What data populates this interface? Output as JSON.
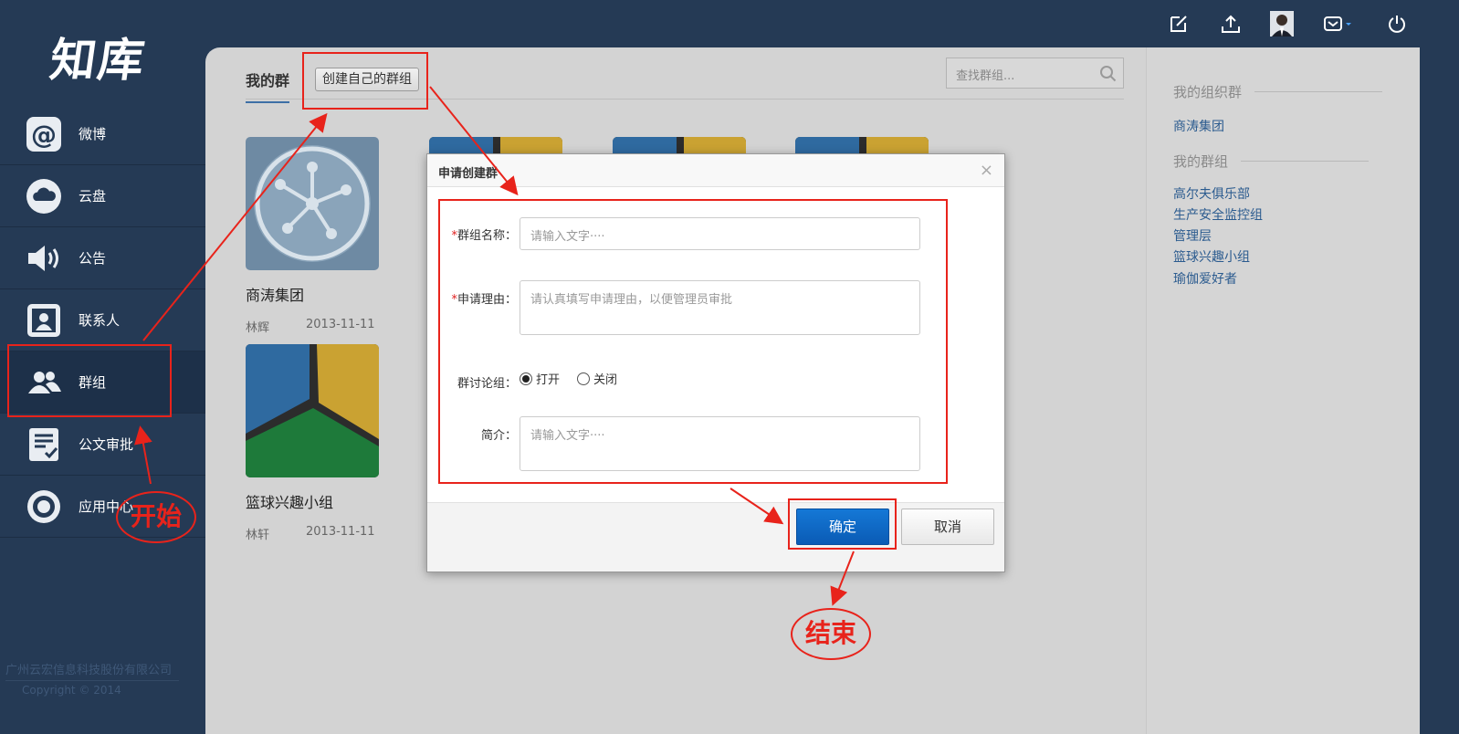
{
  "app": {
    "logo": "知库"
  },
  "sidebar": {
    "items": [
      {
        "label": "微博",
        "icon": "at-icon"
      },
      {
        "label": "云盘",
        "icon": "cloud-icon"
      },
      {
        "label": "公告",
        "icon": "speaker-icon"
      },
      {
        "label": "联系人",
        "icon": "contact-card-icon"
      },
      {
        "label": "群组",
        "icon": "group-users-icon",
        "active": true
      },
      {
        "label": "公文审批",
        "icon": "document-check-icon"
      },
      {
        "label": "应用中心",
        "icon": "app-center-icon"
      }
    ],
    "company": "广州云宏信息科技股份有限公司",
    "copyright": "Copyright  ©  2014"
  },
  "topbar": {
    "icons": [
      "edit-icon",
      "upload-icon",
      "user-avatar",
      "inbox-icon",
      "power-icon"
    ]
  },
  "main": {
    "tab_label": "我的群",
    "create_button": "创建自己的群组",
    "search_placeholder": "查找群组...",
    "cards": [
      {
        "name": "商涛集团",
        "owner": "林辉",
        "date": "2013-11-11"
      },
      {
        "name": "篮球兴趣小组",
        "owner": "林轩",
        "date": "2013-11-11"
      }
    ]
  },
  "right_panel": {
    "org_heading": "我的组织群",
    "org_groups": [
      "商涛集团"
    ],
    "my_heading": "我的群组",
    "my_groups": [
      "高尔夫俱乐部",
      "生产安全监控组",
      "管理层",
      "篮球兴趣小组",
      "瑜伽爱好者"
    ]
  },
  "modal": {
    "title": "申请创建群",
    "close": "×",
    "name_label": "群组名称：",
    "name_placeholder": "请输入文字····",
    "reason_label": "申请理由：",
    "reason_placeholder": "请认真填写申请理由，以便管理员审批",
    "discuss_label": "群讨论组：",
    "radio_on": "打开",
    "radio_off": "关闭",
    "intro_label": "简介：",
    "intro_placeholder": "请输入文字····",
    "ok": "确定",
    "cancel": "取消"
  },
  "annotations": {
    "start": "开始",
    "end": "结束",
    "color": "#e8231b"
  },
  "colors": {
    "sidebar_bg": "#253a55",
    "primary_button": "#0a5bb5",
    "link": "#2b5b8f"
  }
}
